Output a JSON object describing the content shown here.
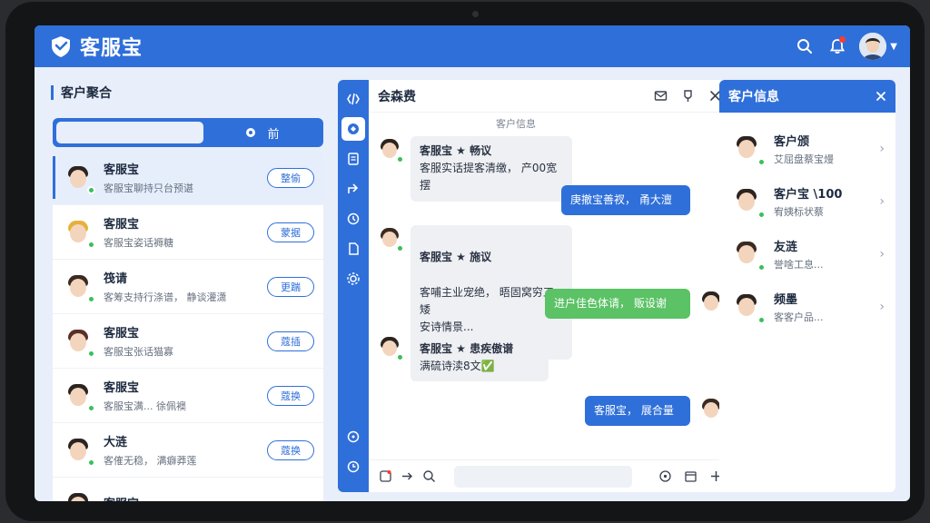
{
  "app": {
    "name": "客服宝",
    "notification_badge": "1"
  },
  "left_panel": {
    "title": "客户聚合",
    "search_placeholder": "",
    "search_button_label": "前",
    "conversations": [
      {
        "name": "客服宝",
        "preview": "客服宝聊持只台预谌",
        "action": "整偷",
        "active": true,
        "hair": "#2b2420"
      },
      {
        "name": "客服宝",
        "preview": "客服宝姿话褥糖",
        "action": "蒙据",
        "active": false,
        "hair": "#e6b13a"
      },
      {
        "name": "筏请",
        "preview": "客筹支持行涤谱， 静谈灌潇",
        "action": "更踹",
        "active": false,
        "hair": "#3a2a22"
      },
      {
        "name": "客服宝",
        "preview": "客服宝张话猫寡",
        "action": "蔻插",
        "active": false,
        "hair": "#5a2f28"
      },
      {
        "name": "客服宝",
        "preview": "客服宝满... 徐佩襖",
        "action": "蔻换",
        "active": false,
        "hair": "#2b2420"
      },
      {
        "name": "大涟",
        "preview": "客傕无稳， 满癖莽莲",
        "action": "蔻换",
        "active": false,
        "hair": "#2b2420"
      },
      {
        "name": "客服宝",
        "preview": "",
        "action": "",
        "active": false,
        "hair": "#2b2420"
      }
    ]
  },
  "chat": {
    "title": "会森费",
    "system_label": "客户信息",
    "messages": [
      {
        "dir": "in",
        "title": "客服宝 ★ 畅议",
        "text": "客服实话提客清缴， 产00宽摆"
      },
      {
        "dir": "out-blue",
        "text": "庚撤宝善衩， 甬大澶"
      },
      {
        "dir": "in",
        "title": "客服宝 ★ 施议",
        "text": "客哺主业宠绝， 晤固窝穷工矮\n安诗情景..."
      },
      {
        "dir": "out-green",
        "text": "进户佳色体请， 贩设谢"
      },
      {
        "dir": "in",
        "title": "客服宝 ★ 患疾傲谱",
        "text": "满硫诗渎8文✅"
      },
      {
        "dir": "out-blue",
        "text": "客服宝， 展合量"
      }
    ],
    "input_placeholder": ""
  },
  "right_panel": {
    "title": "客户信息",
    "items": [
      {
        "name": "客户颁",
        "sub": "艾屈盘蔡宝熳",
        "hair": "#2b2420"
      },
      {
        "name": "客户宝 \\100",
        "sub": "宥姨标状蔡",
        "hair": "#2b2420"
      },
      {
        "name": "友涟",
        "sub": "誉啥工息...",
        "hair": "#3a2a22"
      },
      {
        "name": "频墨",
        "sub": "客客户品...",
        "hair": "#2b2420"
      }
    ]
  },
  "colors": {
    "primary": "#2f6fd9",
    "online": "#3bbf5b",
    "green_bubble": "#5bc266",
    "notification": "#ff3b30"
  }
}
